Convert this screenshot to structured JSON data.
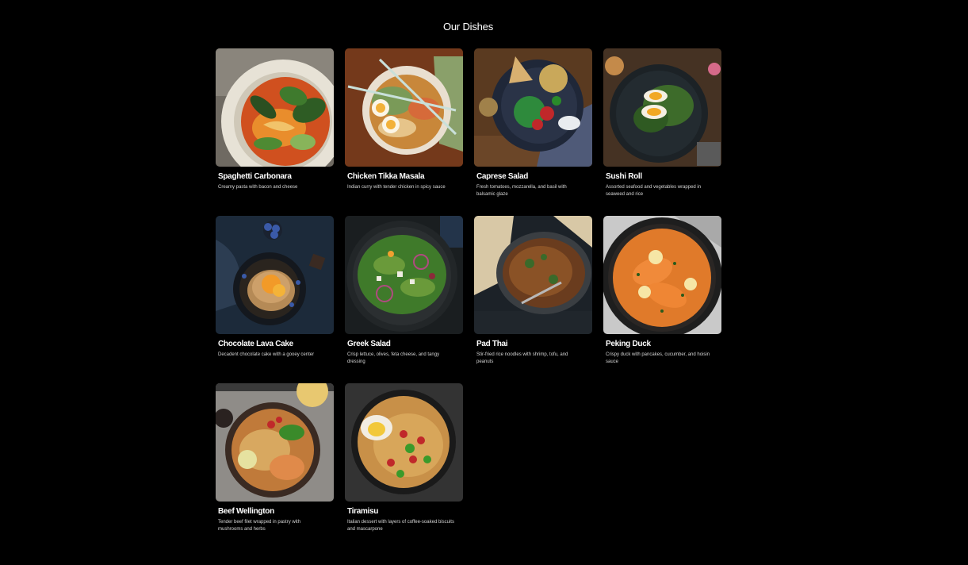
{
  "page": {
    "title": "Our Dishes"
  },
  "dishes": [
    {
      "name": "Spaghetti Carbonara",
      "description": "Creamy pasta with bacon and cheese",
      "image_icon": "bowl-soup-bok-choy-image"
    },
    {
      "name": "Chicken Tikka Masala",
      "description": "Indian curry with tender chicken in spicy sauce",
      "image_icon": "ramen-eggs-chopsticks-image"
    },
    {
      "name": "Caprese Salad",
      "description": "Fresh tomatoes, mozzarella, and basil with balsamic glaze",
      "image_icon": "chickpea-salad-bowl-image"
    },
    {
      "name": "Sushi Roll",
      "description": "Assorted seafood and vegetables wrapped in seaweed and rice",
      "image_icon": "egg-spinach-plate-image"
    },
    {
      "name": "Chocolate Lava Cake",
      "description": "Decadent chocolate cake with a gooey center",
      "image_icon": "pancakes-blueberries-image"
    },
    {
      "name": "Greek Salad",
      "description": "Crisp lettuce, olives, feta cheese, and tangy dressing",
      "image_icon": "greek-salad-bowl-image"
    },
    {
      "name": "Pad Thai",
      "description": "Stir-fried rice noodles with shrimp, tofu, and peanuts",
      "image_icon": "curry-pan-naan-image"
    },
    {
      "name": "Peking Duck",
      "description": "Crispy duck with pancakes, cucumber, and hoisin sauce",
      "image_icon": "salmon-curry-pan-image"
    },
    {
      "name": "Beef Wellington",
      "description": "Tender beef filet wrapped in pastry with mushrooms and herbs",
      "image_icon": "ramen-bowl-lime-image"
    },
    {
      "name": "Tiramisu",
      "description": "Italian dessert with layers of coffee-soaked biscuits and mascarpone",
      "image_icon": "noodle-bowl-egg-image"
    }
  ],
  "colors": {
    "background": "#000000",
    "text": "#ffffff",
    "muted_text": "#d6d6d6"
  }
}
